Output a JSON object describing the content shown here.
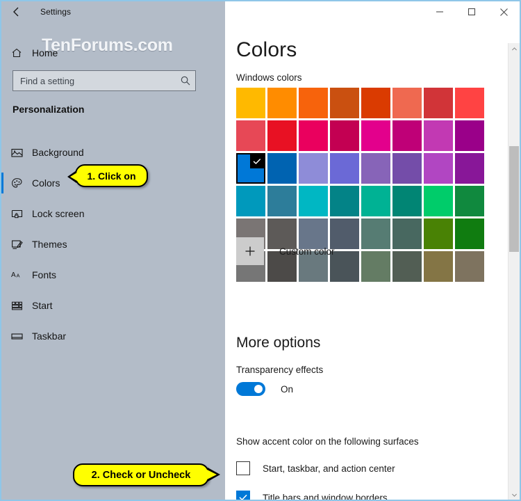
{
  "window": {
    "title": "Settings",
    "back_icon": "back-arrow-icon",
    "minimize_label": "─",
    "maximize_label": "☐",
    "close_label": "✕",
    "border_color": "#8fc6e8"
  },
  "watermark": {
    "text": "TenForums.com"
  },
  "sidebar": {
    "home_label": "Home",
    "home_icon": "home-icon",
    "search": {
      "placeholder": "Find a setting",
      "value": "",
      "icon": "search-icon"
    },
    "section_header": "Personalization",
    "items": [
      {
        "label": "Background",
        "icon": "picture-icon",
        "selected": false
      },
      {
        "label": "Colors",
        "icon": "palette-icon",
        "selected": true
      },
      {
        "label": "Lock screen",
        "icon": "lock-screen-icon",
        "selected": false
      },
      {
        "label": "Themes",
        "icon": "themes-brush-icon",
        "selected": false
      },
      {
        "label": "Fonts",
        "icon": "fonts-aa-icon",
        "selected": false
      },
      {
        "label": "Start",
        "icon": "start-tiles-icon",
        "selected": false
      },
      {
        "label": "Taskbar",
        "icon": "taskbar-icon",
        "selected": false
      }
    ],
    "accent_color": "#0078d7"
  },
  "main": {
    "page_title": "Colors",
    "windows_colors_label": "Windows colors",
    "swatches": [
      {
        "color": "#ffb900",
        "selected": false
      },
      {
        "color": "#ff8c00",
        "selected": false
      },
      {
        "color": "#f7630c",
        "selected": false
      },
      {
        "color": "#ca5010",
        "selected": false
      },
      {
        "color": "#da3b01",
        "selected": false
      },
      {
        "color": "#ef6950",
        "selected": false
      },
      {
        "color": "#d13438",
        "selected": false
      },
      {
        "color": "#ff4343",
        "selected": false
      },
      {
        "color": "#e74856",
        "selected": false
      },
      {
        "color": "#e81123",
        "selected": false
      },
      {
        "color": "#ea005e",
        "selected": false
      },
      {
        "color": "#c30052",
        "selected": false
      },
      {
        "color": "#e3008c",
        "selected": false
      },
      {
        "color": "#bf0077",
        "selected": false
      },
      {
        "color": "#c239b3",
        "selected": false
      },
      {
        "color": "#9a0089",
        "selected": false
      },
      {
        "color": "#0078d7",
        "selected": true
      },
      {
        "color": "#0063b1",
        "selected": false
      },
      {
        "color": "#8e8cd8",
        "selected": false
      },
      {
        "color": "#6b69d6",
        "selected": false
      },
      {
        "color": "#8764b8",
        "selected": false
      },
      {
        "color": "#744da9",
        "selected": false
      },
      {
        "color": "#b146c2",
        "selected": false
      },
      {
        "color": "#881798",
        "selected": false
      },
      {
        "color": "#0099bc",
        "selected": false
      },
      {
        "color": "#2d7d9a",
        "selected": false
      },
      {
        "color": "#00b7c3",
        "selected": false
      },
      {
        "color": "#038387",
        "selected": false
      },
      {
        "color": "#00b294",
        "selected": false
      },
      {
        "color": "#018574",
        "selected": false
      },
      {
        "color": "#00cc6a",
        "selected": false
      },
      {
        "color": "#10893e",
        "selected": false
      },
      {
        "color": "#7a7574",
        "selected": false
      },
      {
        "color": "#5d5a58",
        "selected": false
      },
      {
        "color": "#68768a",
        "selected": false
      },
      {
        "color": "#515c6b",
        "selected": false
      },
      {
        "color": "#567c73",
        "selected": false
      },
      {
        "color": "#486860",
        "selected": false
      },
      {
        "color": "#498205",
        "selected": false
      },
      {
        "color": "#107c10",
        "selected": false
      },
      {
        "color": "#767676",
        "selected": false
      },
      {
        "color": "#4c4a48",
        "selected": false
      },
      {
        "color": "#69797e",
        "selected": false
      },
      {
        "color": "#4a5459",
        "selected": false
      },
      {
        "color": "#647c64",
        "selected": false
      },
      {
        "color": "#525e54",
        "selected": false
      },
      {
        "color": "#847545",
        "selected": false
      },
      {
        "color": "#7e735f",
        "selected": false
      }
    ],
    "custom_color_label": "Custom color",
    "custom_color_icon": "plus-icon",
    "more_options_title": "More options",
    "transparency_label": "Transparency effects",
    "transparency_state": "On",
    "transparency_on": true,
    "accent_surfaces_label": "Show accent color on the following surfaces",
    "checkboxes": [
      {
        "label": "Start, taskbar, and action center",
        "checked": false
      },
      {
        "label": "Title bars and window borders",
        "checked": true
      }
    ]
  },
  "scrollbar": {
    "up_icon": "chevron-up-icon",
    "down_icon": "chevron-down-icon"
  },
  "callouts": [
    {
      "text": "1. Click on"
    },
    {
      "text": "2. Check or Uncheck"
    }
  ]
}
